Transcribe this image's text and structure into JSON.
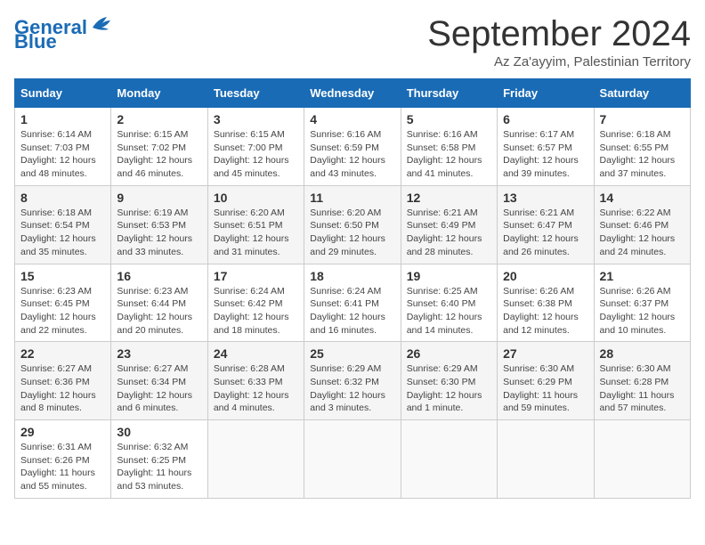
{
  "header": {
    "logo_line1": "General",
    "logo_line2": "Blue",
    "month_title": "September 2024",
    "location": "Az Za'ayyim, Palestinian Territory"
  },
  "weekdays": [
    "Sunday",
    "Monday",
    "Tuesday",
    "Wednesday",
    "Thursday",
    "Friday",
    "Saturday"
  ],
  "weeks": [
    [
      {
        "day": "1",
        "info": "Sunrise: 6:14 AM\nSunset: 7:03 PM\nDaylight: 12 hours\nand 48 minutes."
      },
      {
        "day": "2",
        "info": "Sunrise: 6:15 AM\nSunset: 7:02 PM\nDaylight: 12 hours\nand 46 minutes."
      },
      {
        "day": "3",
        "info": "Sunrise: 6:15 AM\nSunset: 7:00 PM\nDaylight: 12 hours\nand 45 minutes."
      },
      {
        "day": "4",
        "info": "Sunrise: 6:16 AM\nSunset: 6:59 PM\nDaylight: 12 hours\nand 43 minutes."
      },
      {
        "day": "5",
        "info": "Sunrise: 6:16 AM\nSunset: 6:58 PM\nDaylight: 12 hours\nand 41 minutes."
      },
      {
        "day": "6",
        "info": "Sunrise: 6:17 AM\nSunset: 6:57 PM\nDaylight: 12 hours\nand 39 minutes."
      },
      {
        "day": "7",
        "info": "Sunrise: 6:18 AM\nSunset: 6:55 PM\nDaylight: 12 hours\nand 37 minutes."
      }
    ],
    [
      {
        "day": "8",
        "info": "Sunrise: 6:18 AM\nSunset: 6:54 PM\nDaylight: 12 hours\nand 35 minutes."
      },
      {
        "day": "9",
        "info": "Sunrise: 6:19 AM\nSunset: 6:53 PM\nDaylight: 12 hours\nand 33 minutes."
      },
      {
        "day": "10",
        "info": "Sunrise: 6:20 AM\nSunset: 6:51 PM\nDaylight: 12 hours\nand 31 minutes."
      },
      {
        "day": "11",
        "info": "Sunrise: 6:20 AM\nSunset: 6:50 PM\nDaylight: 12 hours\nand 29 minutes."
      },
      {
        "day": "12",
        "info": "Sunrise: 6:21 AM\nSunset: 6:49 PM\nDaylight: 12 hours\nand 28 minutes."
      },
      {
        "day": "13",
        "info": "Sunrise: 6:21 AM\nSunset: 6:47 PM\nDaylight: 12 hours\nand 26 minutes."
      },
      {
        "day": "14",
        "info": "Sunrise: 6:22 AM\nSunset: 6:46 PM\nDaylight: 12 hours\nand 24 minutes."
      }
    ],
    [
      {
        "day": "15",
        "info": "Sunrise: 6:23 AM\nSunset: 6:45 PM\nDaylight: 12 hours\nand 22 minutes."
      },
      {
        "day": "16",
        "info": "Sunrise: 6:23 AM\nSunset: 6:44 PM\nDaylight: 12 hours\nand 20 minutes."
      },
      {
        "day": "17",
        "info": "Sunrise: 6:24 AM\nSunset: 6:42 PM\nDaylight: 12 hours\nand 18 minutes."
      },
      {
        "day": "18",
        "info": "Sunrise: 6:24 AM\nSunset: 6:41 PM\nDaylight: 12 hours\nand 16 minutes."
      },
      {
        "day": "19",
        "info": "Sunrise: 6:25 AM\nSunset: 6:40 PM\nDaylight: 12 hours\nand 14 minutes."
      },
      {
        "day": "20",
        "info": "Sunrise: 6:26 AM\nSunset: 6:38 PM\nDaylight: 12 hours\nand 12 minutes."
      },
      {
        "day": "21",
        "info": "Sunrise: 6:26 AM\nSunset: 6:37 PM\nDaylight: 12 hours\nand 10 minutes."
      }
    ],
    [
      {
        "day": "22",
        "info": "Sunrise: 6:27 AM\nSunset: 6:36 PM\nDaylight: 12 hours\nand 8 minutes."
      },
      {
        "day": "23",
        "info": "Sunrise: 6:27 AM\nSunset: 6:34 PM\nDaylight: 12 hours\nand 6 minutes."
      },
      {
        "day": "24",
        "info": "Sunrise: 6:28 AM\nSunset: 6:33 PM\nDaylight: 12 hours\nand 4 minutes."
      },
      {
        "day": "25",
        "info": "Sunrise: 6:29 AM\nSunset: 6:32 PM\nDaylight: 12 hours\nand 3 minutes."
      },
      {
        "day": "26",
        "info": "Sunrise: 6:29 AM\nSunset: 6:30 PM\nDaylight: 12 hours\nand 1 minute."
      },
      {
        "day": "27",
        "info": "Sunrise: 6:30 AM\nSunset: 6:29 PM\nDaylight: 11 hours\nand 59 minutes."
      },
      {
        "day": "28",
        "info": "Sunrise: 6:30 AM\nSunset: 6:28 PM\nDaylight: 11 hours\nand 57 minutes."
      }
    ],
    [
      {
        "day": "29",
        "info": "Sunrise: 6:31 AM\nSunset: 6:26 PM\nDaylight: 11 hours\nand 55 minutes."
      },
      {
        "day": "30",
        "info": "Sunrise: 6:32 AM\nSunset: 6:25 PM\nDaylight: 11 hours\nand 53 minutes."
      },
      {
        "day": "",
        "info": ""
      },
      {
        "day": "",
        "info": ""
      },
      {
        "day": "",
        "info": ""
      },
      {
        "day": "",
        "info": ""
      },
      {
        "day": "",
        "info": ""
      }
    ]
  ]
}
